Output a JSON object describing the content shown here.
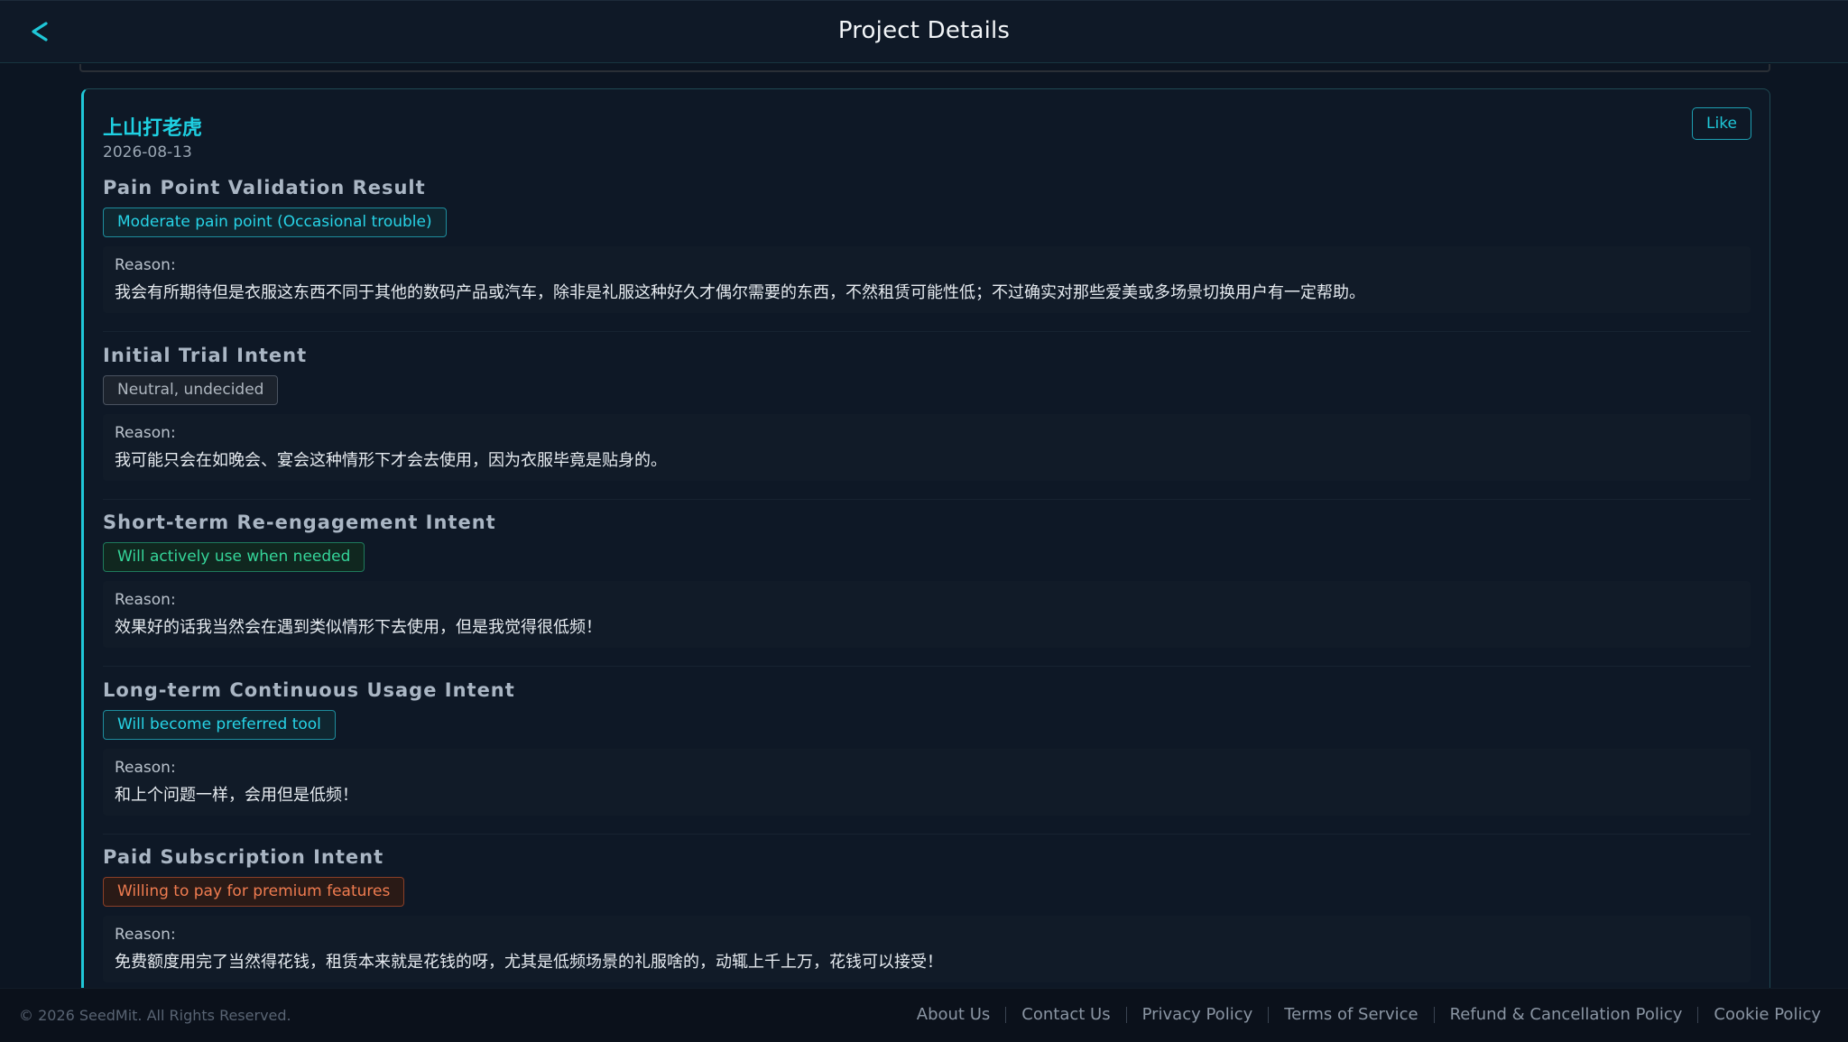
{
  "header": {
    "title": "Project Details",
    "back_label": "<"
  },
  "card": {
    "title": "上山打老虎",
    "date": "2026-08-13",
    "like_label": "Like",
    "sections": [
      {
        "title": "Pain Point Validation Result",
        "badge": "Moderate pain point (Occasional trouble)",
        "badge_color": "#27d3e6",
        "reason_label": "Reason:",
        "reason": "我会有所期待但是衣服这东西不同于其他的数码产品或汽车，除非是礼服这种好久才偶尔需要的东西，不然租赁可能性低；不过确实对那些爱美或多场景切换用户有一定帮助。"
      },
      {
        "title": "Initial Trial Intent",
        "badge": "Neutral, undecided",
        "badge_color": "#aeb6bf",
        "reason_label": "Reason:",
        "reason": "我可能只会在如晚会、宴会这种情形下才会去使用，因为衣服毕竟是贴身的。"
      },
      {
        "title": "Short-term Re-engagement Intent",
        "badge": "Will actively use when needed",
        "badge_color": "#35d69a",
        "reason_label": "Reason:",
        "reason": "效果好的话我当然会在遇到类似情形下去使用，但是我觉得很低频！"
      },
      {
        "title": "Long-term Continuous Usage Intent",
        "badge": "Will become preferred tool",
        "badge_color": "#27d3e6",
        "reason_label": "Reason:",
        "reason": "和上个问题一样，会用但是低频！"
      },
      {
        "title": "Paid Subscription Intent",
        "badge": "Willing to pay for premium features",
        "badge_color": "#f07c50",
        "reason_label": "Reason:",
        "reason": "免费额度用完了当然得花钱，租赁本来就是花钱的呀，尤其是低频场景的礼服啥的，动辄上千上万，花钱可以接受！"
      }
    ]
  },
  "footer": {
    "copyright": "© 2026 SeedMit. All Rights Reserved.",
    "links": [
      "About Us",
      "Contact Us",
      "Privacy Policy",
      "Terms of Service",
      "Refund & Cancellation Policy",
      "Cookie Policy"
    ]
  },
  "colors": {
    "accent": "#1fc7d8",
    "background": "#0c1522"
  }
}
